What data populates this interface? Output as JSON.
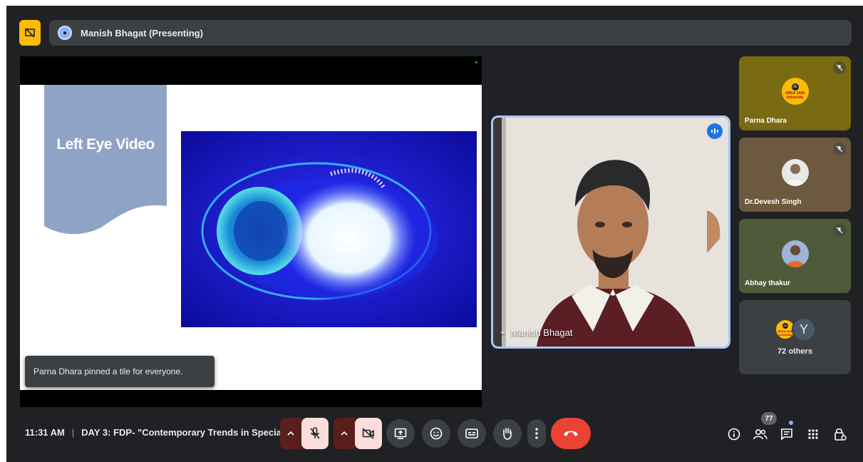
{
  "top_bar": {
    "presenter_label": "Manish Bhagat (Presenting)"
  },
  "slide": {
    "title": "Left Eye Video"
  },
  "toast": {
    "message": "Parna Dhara pinned a tile for everyone."
  },
  "main_speaker": {
    "name": "Manish Bhagat"
  },
  "participants": [
    {
      "name": "Parna Dhara",
      "muted": true,
      "avatar": "jain-logo",
      "bg": "#7a6a12"
    },
    {
      "name": "Dr.Devesh Singh",
      "muted": true,
      "avatar": "photo",
      "bg": "#6d5a3e"
    },
    {
      "name": "Abhay thakur",
      "muted": true,
      "avatar": "photo",
      "bg": "#4e5a3a"
    }
  ],
  "others": {
    "count_label": "72 others",
    "initial": "Y"
  },
  "bottom_bar": {
    "time": "11:31 AM",
    "meeting_title": "DAY 3: FDP- \"Contemporary Trends in Special...",
    "people_count": "77"
  },
  "colors": {
    "background": "#202124",
    "accent_blue": "#a8c7fa",
    "leave_red": "#ea4335",
    "presenting_yellow": "#fbbc04"
  }
}
